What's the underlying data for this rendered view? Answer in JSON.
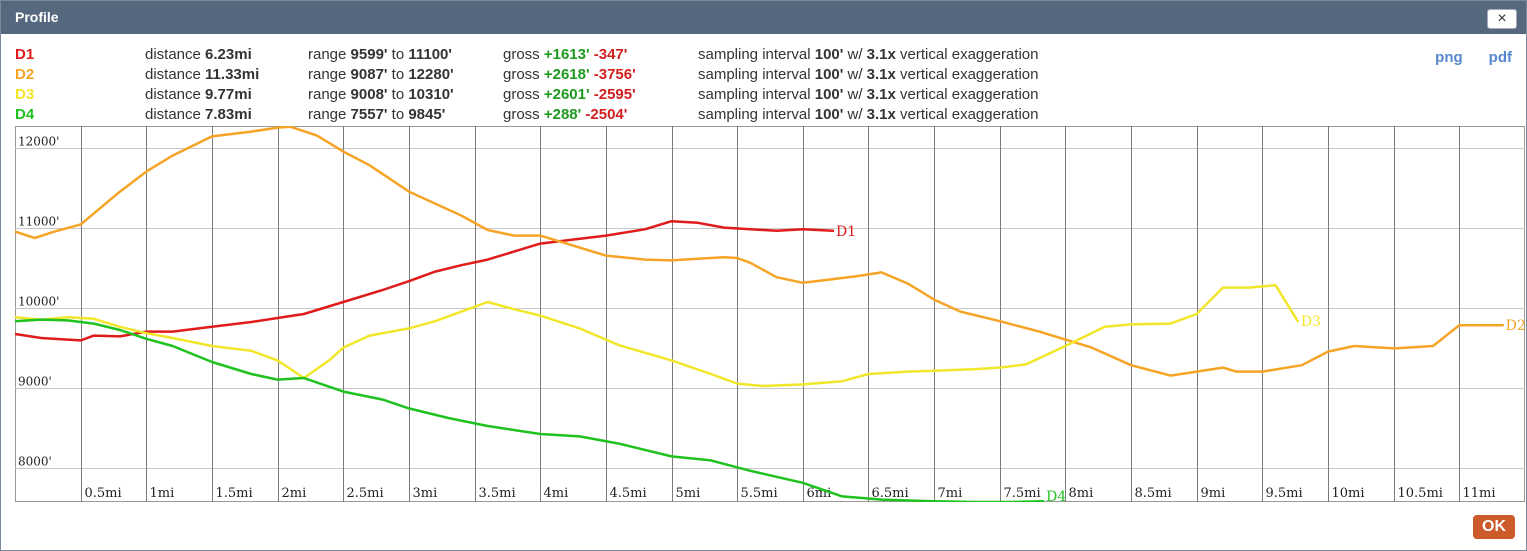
{
  "window": {
    "title": "Profile",
    "close_label": "×"
  },
  "export": {
    "png_label": "png",
    "pdf_label": "pdf"
  },
  "ok_label": "OK",
  "routes": [
    {
      "name": "D1",
      "color": "#e01b1b",
      "distance": "6.23mi",
      "range_min": "9599'",
      "range_max": "11100'",
      "gain": "+1613'",
      "loss": "-347'",
      "interval": "100'",
      "exaggeration": "3.1x"
    },
    {
      "name": "D2",
      "color": "#f5a425",
      "distance": "11.33mi",
      "range_min": "9087'",
      "range_max": "12280'",
      "gain": "+2618'",
      "loss": "-3756'",
      "interval": "100'",
      "exaggeration": "3.1x"
    },
    {
      "name": "D3",
      "color": "#f2e62a",
      "distance": "9.77mi",
      "range_min": "9008'",
      "range_max": "10310'",
      "gain": "+2601'",
      "loss": "-2595'",
      "interval": "100'",
      "exaggeration": "3.1x"
    },
    {
      "name": "D4",
      "color": "#1fc21f",
      "distance": "7.83mi",
      "range_min": "7557'",
      "range_max": "9845'",
      "gain": "+288'",
      "loss": "-2504'",
      "interval": "100'",
      "exaggeration": "3.1x"
    }
  ],
  "labels": {
    "distance": "distance",
    "range": "range",
    "to": "to",
    "gross": "gross",
    "sampling": "sampling interval",
    "with": "w/",
    "vertical": "vertical exaggeration"
  },
  "chart_data": {
    "type": "line",
    "xlim": [
      0,
      11.5
    ],
    "ylim": [
      7570,
      12270
    ],
    "grid": true,
    "xticks": [
      0.5,
      1,
      1.5,
      2,
      2.5,
      3,
      3.5,
      4,
      4.5,
      5,
      5.5,
      6,
      6.5,
      7,
      7.5,
      8,
      8.5,
      9,
      9.5,
      10,
      10.5,
      11
    ],
    "xtick_labels": [
      "0.5mi",
      "1mi",
      "1.5mi",
      "2mi",
      "2.5mi",
      "3mi",
      "3.5mi",
      "4mi",
      "4.5mi",
      "5mi",
      "5.5mi",
      "6mi",
      "6.5mi",
      "7mi",
      "7.5mi",
      "8mi",
      "8.5mi",
      "9mi",
      "9.5mi",
      "10mi",
      "10.5mi",
      "11mi"
    ],
    "yticks": [
      8000,
      9000,
      10000,
      11000,
      12000
    ],
    "ytick_labels": [
      "8000'",
      "9000'",
      "10000'",
      "11000'",
      "12000'"
    ],
    "series": [
      {
        "name": "D1",
        "color": "#e01b1b",
        "x": [
          0,
          0.2,
          0.4,
          0.5,
          0.6,
          0.8,
          1.0,
          1.2,
          1.5,
          1.8,
          2.0,
          2.2,
          2.5,
          2.8,
          3.0,
          3.2,
          3.4,
          3.6,
          3.8,
          4.0,
          4.2,
          4.5,
          4.8,
          5.0,
          5.2,
          5.4,
          5.6,
          5.8,
          6.0,
          6.23
        ],
        "y": [
          9670,
          9620,
          9600,
          9590,
          9650,
          9640,
          9700,
          9700,
          9760,
          9820,
          9870,
          9920,
          10070,
          10220,
          10330,
          10450,
          10530,
          10600,
          10700,
          10800,
          10840,
          10900,
          10980,
          11080,
          11060,
          11000,
          10980,
          10960,
          10980,
          10960
        ]
      },
      {
        "name": "D2",
        "color": "#f5a425",
        "x": [
          0,
          0.15,
          0.3,
          0.5,
          0.8,
          1.0,
          1.2,
          1.5,
          1.8,
          2.0,
          2.1,
          2.3,
          2.5,
          2.7,
          3.0,
          3.2,
          3.4,
          3.6,
          3.8,
          4.0,
          4.2,
          4.5,
          4.8,
          5.0,
          5.2,
          5.4,
          5.5,
          5.6,
          5.8,
          6.0,
          6.2,
          6.4,
          6.6,
          6.8,
          7.0,
          7.2,
          7.5,
          7.8,
          8.0,
          8.2,
          8.5,
          8.8,
          9.0,
          9.2,
          9.3,
          9.5,
          9.8,
          10.0,
          10.2,
          10.5,
          10.8,
          11.0,
          11.33
        ],
        "y": [
          10950,
          10870,
          10950,
          11040,
          11450,
          11700,
          11900,
          12140,
          12200,
          12250,
          12260,
          12150,
          11950,
          11780,
          11450,
          11300,
          11150,
          10970,
          10900,
          10900,
          10800,
          10650,
          10600,
          10590,
          10610,
          10630,
          10620,
          10560,
          10380,
          10310,
          10350,
          10390,
          10440,
          10300,
          10100,
          9950,
          9830,
          9700,
          9600,
          9500,
          9280,
          9150,
          9200,
          9250,
          9200,
          9200,
          9280,
          9450,
          9520,
          9490,
          9520,
          9780,
          9780
        ]
      },
      {
        "name": "D3",
        "color": "#f2e62a",
        "x": [
          0,
          0.2,
          0.4,
          0.6,
          0.8,
          1.0,
          1.2,
          1.5,
          1.8,
          2.0,
          2.2,
          2.4,
          2.5,
          2.7,
          3.0,
          3.2,
          3.4,
          3.6,
          3.8,
          4.0,
          4.3,
          4.6,
          5.0,
          5.3,
          5.5,
          5.7,
          6.0,
          6.3,
          6.5,
          6.8,
          7.0,
          7.3,
          7.5,
          7.7,
          8.0,
          8.3,
          8.5,
          8.8,
          9.0,
          9.2,
          9.4,
          9.6,
          9.77
        ],
        "y": [
          9880,
          9850,
          9880,
          9860,
          9760,
          9680,
          9620,
          9520,
          9460,
          9340,
          9120,
          9350,
          9500,
          9650,
          9740,
          9830,
          9950,
          10070,
          9980,
          9900,
          9740,
          9530,
          9340,
          9170,
          9050,
          9020,
          9040,
          9080,
          9170,
          9200,
          9210,
          9230,
          9250,
          9290,
          9520,
          9760,
          9790,
          9800,
          9920,
          10250,
          10250,
          10280,
          9830
        ]
      },
      {
        "name": "D4",
        "color": "#1fc21f",
        "x": [
          0,
          0.2,
          0.4,
          0.6,
          0.8,
          1.0,
          1.2,
          1.5,
          1.8,
          2.0,
          2.2,
          2.5,
          2.8,
          3.0,
          3.3,
          3.6,
          4.0,
          4.3,
          4.6,
          5.0,
          5.3,
          5.6,
          6.0,
          6.3,
          6.6,
          7.0,
          7.3,
          7.6,
          7.83
        ],
        "y": [
          9830,
          9850,
          9840,
          9800,
          9720,
          9610,
          9520,
          9320,
          9170,
          9100,
          9120,
          8950,
          8850,
          8740,
          8620,
          8520,
          8420,
          8390,
          8300,
          8140,
          8090,
          7960,
          7810,
          7640,
          7600,
          7580,
          7570,
          7570,
          7580
        ]
      }
    ]
  }
}
